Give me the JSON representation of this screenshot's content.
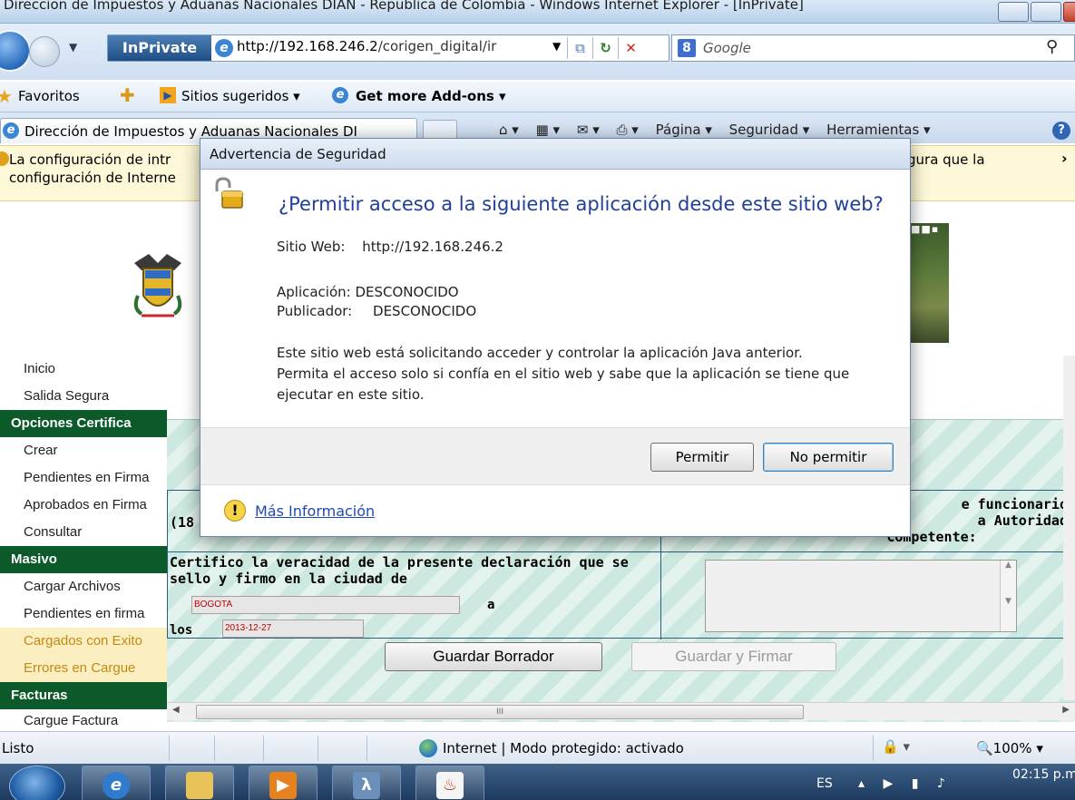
{
  "window": {
    "title": "Direccion de Impuestos y Aduanas Nacionales DIAN - Republica de Colombia - Windows Internet Explorer - [InPrivate]"
  },
  "address_bar": {
    "inprivate_label": "InPrivate",
    "url_host": "http://192.168.246.2",
    "url_path": "/corigen_digital/ir",
    "search_placeholder": "Google"
  },
  "favorites_bar": {
    "favorites_label": "Favoritos",
    "suggested_label": "Sitios sugeridos ▾",
    "addons_label": "Get more Add-ons ▾"
  },
  "tab": {
    "title": "Dirección de Impuestos y Aduanas Nacionales DI"
  },
  "command_bar": {
    "home": "⌂ ▾",
    "feeds": "▦ ▾",
    "mail": "✉ ▾",
    "print": "⎙ ▾",
    "page": "Página ▾",
    "security": "Seguridad ▾",
    "tools": "Herramientas ▾"
  },
  "info_bar": {
    "line1_start": "La configuración de intr",
    "line1_end": "gura que la",
    "line2": "configuración de Interne"
  },
  "sidebar": {
    "items": [
      {
        "label": "Inicio"
      },
      {
        "label": "Salida Segura"
      },
      {
        "label": "Opciones Certifica"
      },
      {
        "label": "Crear"
      },
      {
        "label": "Pendientes en Firma"
      },
      {
        "label": "Aprobados en Firma"
      },
      {
        "label": "Consultar"
      },
      {
        "label": "Masivo"
      },
      {
        "label": "Cargar Archivos"
      },
      {
        "label": "Pendientes en firma"
      },
      {
        "label": "Cargados con Exito"
      },
      {
        "label": "Errores en Cargue"
      },
      {
        "label": "Facturas"
      },
      {
        "label": "Cargue Factura"
      }
    ]
  },
  "form": {
    "cell_18": "(18",
    "func_line1": "e funcionario",
    "func_line2": "a Autoridad",
    "func_line3": "Competente:",
    "certify_text": "Certifico la veracidad de la presente declaración que se sello y firmo en la ciudad de",
    "city_value": "BOGOTA",
    "a_label": "a",
    "los_label": "los",
    "date_value": "2013-12-27",
    "save_draft_label": "Guardar Borrador",
    "save_sign_label": "Guardar y Firmar",
    "hscroll_grip": "III"
  },
  "status_bar": {
    "status": "Listo",
    "zone": "Internet | Modo protegido: activado",
    "security_icons": "🔒 ▾",
    "zoom": "🔍100%  ▾"
  },
  "taskbar": {
    "lang": "ES",
    "tray": "▴ ▶ ▮ ♪",
    "clock": "02:15 p.m"
  },
  "dialog": {
    "title": "Advertencia de Seguridad",
    "question": "¿Permitir acceso a la siguiente aplicación desde este sitio web?",
    "site_label": "Sitio Web:",
    "site_value": "http://192.168.246.2",
    "application": "Aplicación: DESCONOCIDO",
    "publisher_label": "Publicador:",
    "publisher_value": "DESCONOCIDO",
    "message_line1": "Este sitio web está solicitando acceder y controlar la aplicación Java anterior.",
    "message_line2": "Permita el acceso solo si confía en el sitio web y sabe que la aplicación se tiene que",
    "message_line3": "ejecutar en este sitio.",
    "allow_label": "Permitir",
    "deny_label": "No permitir",
    "more_info_label": "Más Información"
  }
}
